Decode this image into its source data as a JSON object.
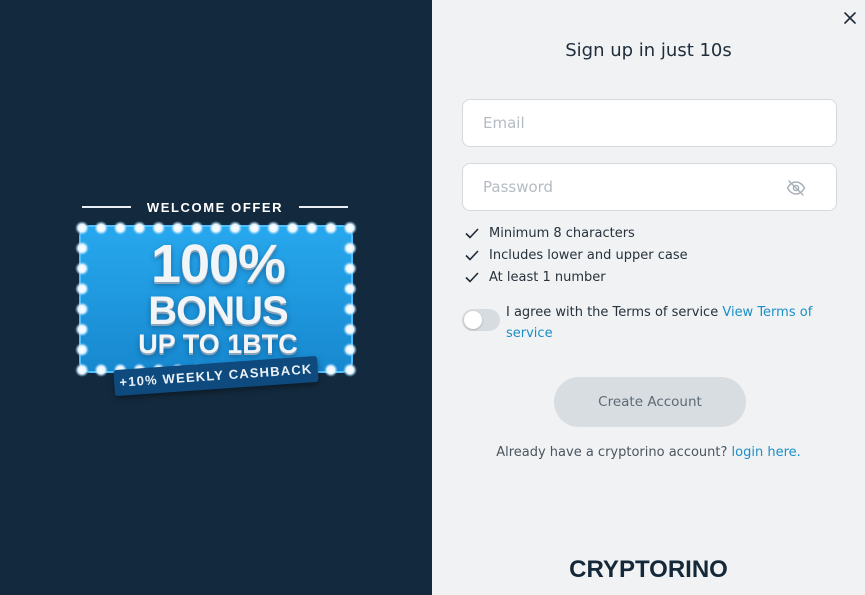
{
  "promo": {
    "welcome": "WELCOME OFFER",
    "bonus_line1": "100%",
    "bonus_line2": "BONUS",
    "bonus_line3": "UP TO 1BTC",
    "cashback": "+10% WEEKLY CASHBACK"
  },
  "form": {
    "title": "Sign up in just 10s",
    "email_placeholder": "Email",
    "password_placeholder": "Password",
    "rules": [
      "Minimum 8 characters",
      "Includes lower and upper case",
      "At least 1 number"
    ],
    "agree_text": "I agree with the Terms of service",
    "terms_link": "View Terms of service",
    "create_button": "Create Account",
    "login_prompt": "Already have a cryptorino account?",
    "login_link": "login here.",
    "logo": "CRYPTORINO"
  },
  "colors": {
    "left_bg": "#132a3e",
    "right_bg": "#f0f2f3",
    "accent_link": "#1b8fc7",
    "board_blue": "#1b9de4",
    "button_bg": "#d8dde1"
  },
  "icons": {
    "close": "close-icon",
    "eye": "eye-slash-icon",
    "check": "check-icon"
  }
}
